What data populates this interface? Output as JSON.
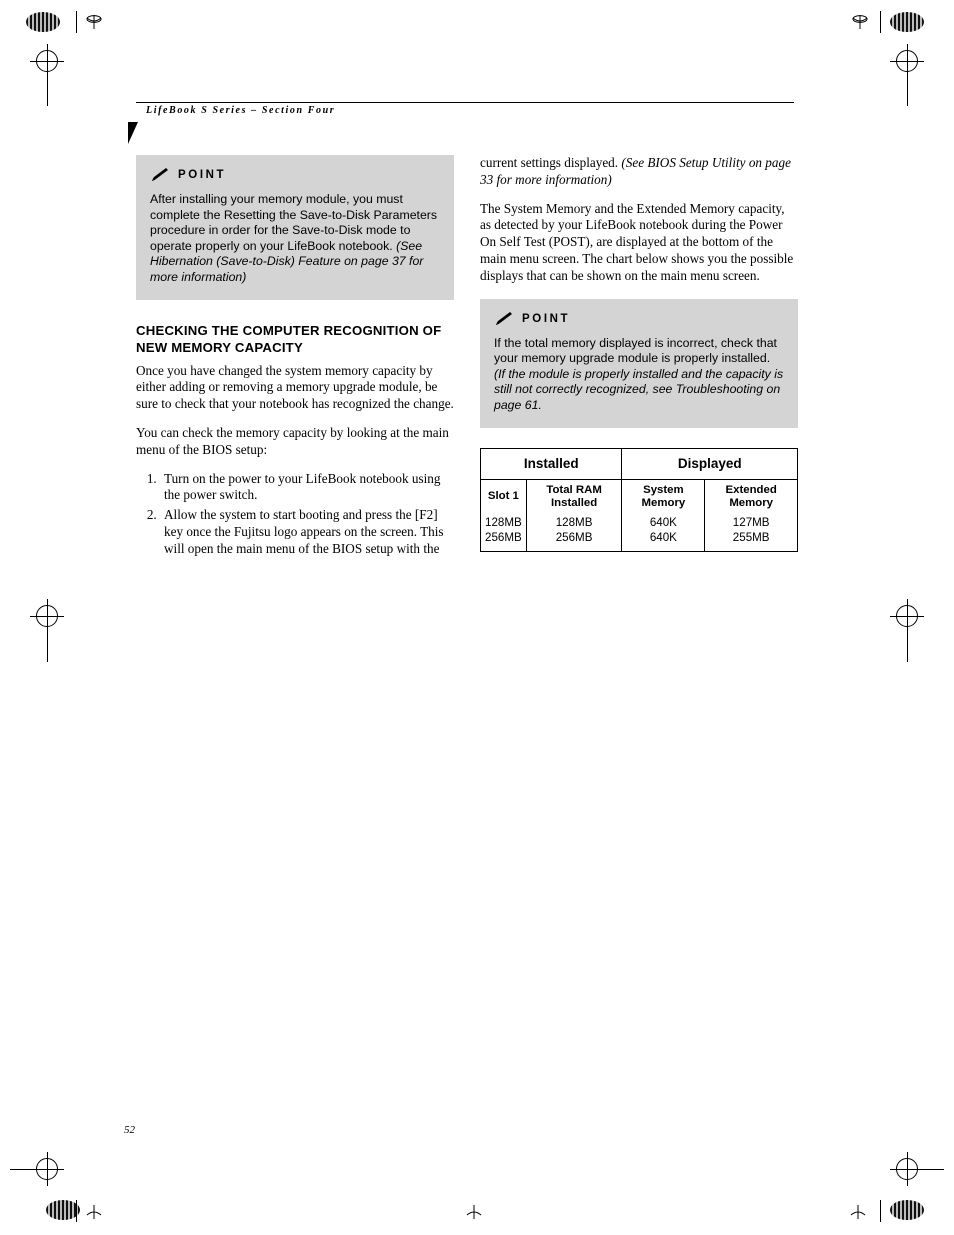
{
  "header": {
    "running_head": "LifeBook S Series – Section Four"
  },
  "page_number": "52",
  "left_column": {
    "point_box": {
      "label": "POINT",
      "icon": "pencil-icon",
      "text_plain": "After installing your memory module, you must complete the Resetting the Save-to-Disk Parameters procedure in order for the Save-to-Disk mode to operate properly on your LifeBook notebook. ",
      "text_italic": "(See Hibernation (Save-to-Disk) Feature on page 37 for more information)"
    },
    "heading": "CHECKING THE COMPUTER RECOGNITION OF NEW MEMORY CAPACITY",
    "paragraph_1": "Once you have changed the system memory capacity by either adding or removing a memory upgrade module, be sure to check that your notebook has recognized the change.",
    "paragraph_2": "You can check the memory capacity by looking at the main menu of the BIOS setup:",
    "steps": [
      "Turn on the power to your LifeBook notebook using the power switch.",
      "Allow the system to start booting and press the [F2] key once the Fujitsu logo appears on the screen. This will open the main menu of the BIOS setup with the"
    ]
  },
  "right_column": {
    "continued_text_plain": "current settings displayed. ",
    "continued_text_italic": "(See BIOS Setup Utility on page 33 for more information)",
    "paragraph_1": "The System Memory and the Extended Memory capacity, as detected by your LifeBook notebook during the Power On Self Test (POST), are displayed at the bottom of the main menu screen. The chart below shows you the possible displays that can be shown on the main menu screen.",
    "point_box": {
      "label": "POINT",
      "icon": "pencil-icon",
      "text_plain": "If the total memory displayed is incorrect, check that your memory upgrade module is properly installed. ",
      "text_italic": "(If the module is properly installed and the capacity is still not correctly recognized, see Troubleshooting on page 61."
    },
    "table": {
      "group_headers": [
        "Installed",
        "Displayed"
      ],
      "column_headers": [
        "Slot 1",
        "Total RAM Installed",
        "System Memory",
        "Extended Memory"
      ],
      "rows": [
        [
          "128MB",
          "128MB",
          "640K",
          "127MB"
        ],
        [
          "256MB",
          "256MB",
          "640K",
          "255MB"
        ]
      ]
    }
  }
}
